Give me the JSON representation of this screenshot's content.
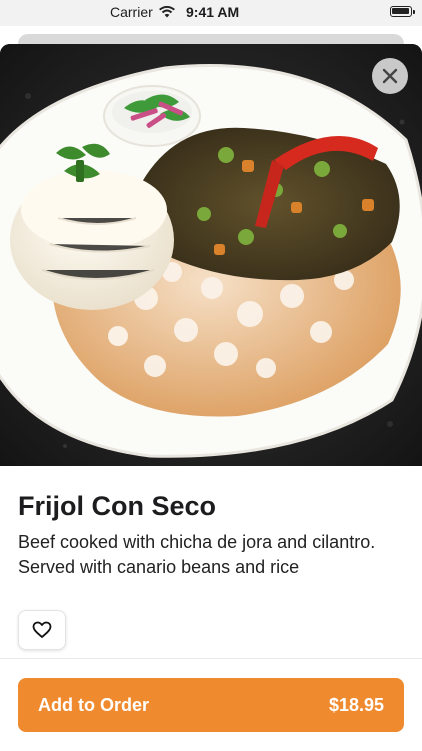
{
  "status": {
    "carrier": "Carrier",
    "time": "9:41 AM"
  },
  "item": {
    "title": "Frijol Con Seco",
    "description": "Beef cooked with chicha de jora and cilantro. Served with canario beans and rice",
    "image_icon": "food-photo"
  },
  "actions": {
    "close_icon": "close-icon",
    "favorite_icon": "heart-outline-icon",
    "add_label": "Add to Order",
    "price": "$18.95"
  },
  "colors": {
    "accent": "#f08a2f"
  }
}
